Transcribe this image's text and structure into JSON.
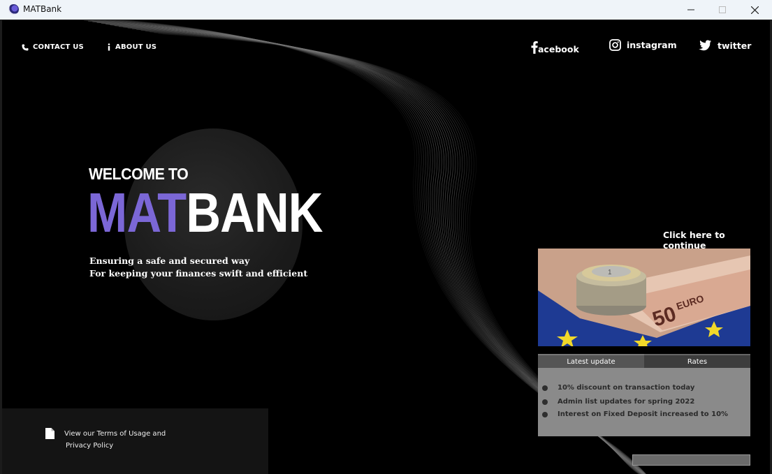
{
  "window": {
    "title": "MATBank"
  },
  "nav": {
    "contact_label": "CONTACT US",
    "about_label": "ABOUT US"
  },
  "social": {
    "facebook": "acebook",
    "instagram": "instagram",
    "twitter": "twitter"
  },
  "hero": {
    "welcome": "WELCOME TO",
    "brand_accent": "MAT",
    "brand_main": "BANK",
    "tagline_1": "Ensuring a safe and secured way",
    "tagline_2": "For keeping your finances swift and efficient"
  },
  "footer": {
    "terms_line_1": "View our Terms of Usage and",
    "terms_line_2": "Privacy Policy"
  },
  "panel": {
    "continue_label": "Click here to continue",
    "tabs": [
      {
        "label": "Latest update"
      },
      {
        "label": "Rates"
      }
    ],
    "updates": [
      "10% discount on transaction today",
      "Admin list updates for spring 2022",
      "Interest on Fixed Deposit increased to 10%"
    ],
    "promo_banknote_text": "50 EURO"
  },
  "colors": {
    "accent": "#7b67d6",
    "background": "#000000",
    "update_panel": "#8a8a8a"
  }
}
